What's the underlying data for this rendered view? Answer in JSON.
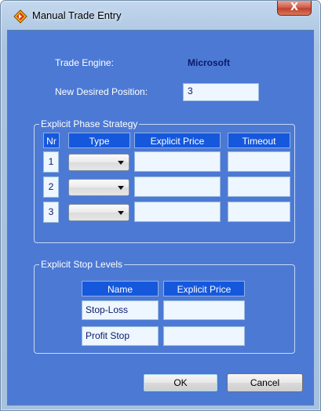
{
  "window": {
    "title": "Manual Trade Entry",
    "app_icon": "trade-app-icon",
    "close_label": "X"
  },
  "form": {
    "trade_engine_label": "Trade Engine:",
    "trade_engine_value": "Microsoft",
    "desired_position_label": "New Desired Position:",
    "desired_position_value": "3"
  },
  "phase_strategy": {
    "group_title": "Explicit Phase Strategy",
    "headers": {
      "nr": "Nr",
      "type": "Type",
      "price": "Explicit Price",
      "timeout": "Timeout"
    },
    "rows": [
      {
        "nr": "1",
        "type": "",
        "price": "",
        "timeout": ""
      },
      {
        "nr": "2",
        "type": "",
        "price": "",
        "timeout": ""
      },
      {
        "nr": "3",
        "type": "",
        "price": "",
        "timeout": ""
      }
    ]
  },
  "stop_levels": {
    "group_title": "Explicit Stop Levels",
    "headers": {
      "name": "Name",
      "price": "Explicit Price"
    },
    "rows": [
      {
        "name": "Stop-Loss",
        "price": ""
      },
      {
        "name": "Profit Stop",
        "price": ""
      }
    ]
  },
  "buttons": {
    "ok": "OK",
    "cancel": "Cancel"
  },
  "colors": {
    "client_bg": "#4c79d4",
    "header_bg": "#1558dc",
    "value_text": "#0b1a6b",
    "field_bg": "#eef6ff"
  }
}
